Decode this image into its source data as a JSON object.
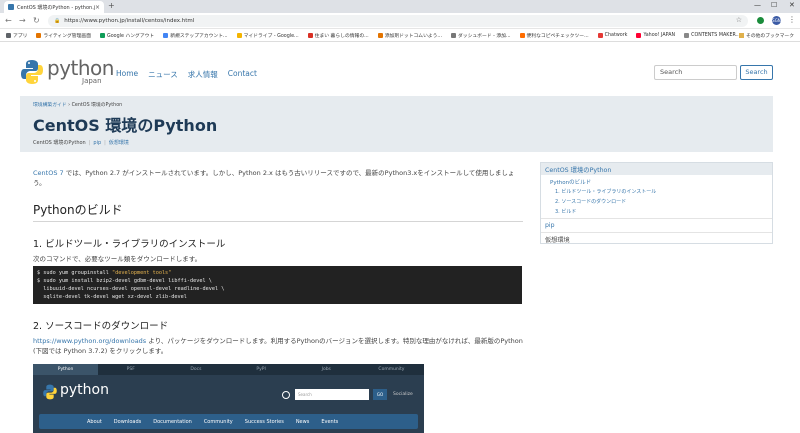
{
  "browser": {
    "tab_title": "CentOS 環境のPython - python.jp",
    "url": "https://www.python.jp/install/centos/index.html",
    "bookmarks": [
      {
        "label": "アプリ",
        "color": "#5f6368"
      },
      {
        "label": "ライティング管理画面",
        "color": "#e37400"
      },
      {
        "label": "Google ハングアウト",
        "color": "#0f9d58"
      },
      {
        "label": "新規ステップアカウント...",
        "color": "#4285f4"
      },
      {
        "label": "マイドライブ - Google...",
        "color": "#f4b400"
      },
      {
        "label": "住まい 暮らしの情報の...",
        "color": "#d93025"
      },
      {
        "label": "添加剤ドットコムいよう...",
        "color": "#e37400"
      },
      {
        "label": "ダッシュボード - 添加...",
        "color": "#777777"
      },
      {
        "label": "便利なコピペチェックツー...",
        "color": "#ff6d00"
      },
      {
        "label": "Chatwork",
        "color": "#e53935"
      },
      {
        "label": "Yahoo! JAPAN",
        "color": "#ff0033"
      },
      {
        "label": "CONTENTS MAKER...",
        "color": "#888888"
      }
    ],
    "other_bookmarks": "その他のブックマーク",
    "profile_initials": "SGN"
  },
  "header": {
    "logo_text": "python",
    "logo_sub": "Japan",
    "nav": [
      "Home",
      "ニュース",
      "求人情報",
      "Contact"
    ],
    "search_placeholder": "Search",
    "search_button": "Search"
  },
  "hero": {
    "breadcrumb_link": "環境構築ガイド",
    "breadcrumb_sep": "›",
    "breadcrumb_current": "CentOS 環境のPython",
    "title": "CentOS 環境のPython",
    "local_nav": [
      "CentOS 環境のPython",
      "pip",
      "仮想環境"
    ]
  },
  "content": {
    "intro_link": "CentOS 7",
    "intro_text": " では、Python 2.7 がインストールされています。しかし、Python 2.x はもう古いリリースですので、最新のPython3.xをインストールして使用しましょう。",
    "h1": "Pythonのビルド",
    "h2_1": "1. ビルドツール・ライブラリのインストール",
    "p_1": "次のコマンドで、必要なツール類をダウンロードします。",
    "code": {
      "line1_cmd": "$ sudo yum groupinstall ",
      "line1_str": "\"development tools\"",
      "line2": "$ sudo yum install bzip2-devel gdbm-devel libffi-devel \\",
      "line3": "  libuuid-devel ncurses-devel openssl-devel readline-devel \\",
      "line4": "  sqlite-devel tk-devel wget xz-devel zlib-devel"
    },
    "h2_2": "2. ソースコードのダウンロード",
    "p_2_link": "https://www.python.org/downloads",
    "p_2_text": " より、パッケージをダウンロードします。利用するPythonのバージョンを選択します。特別な理由がなければ、最新版のPython (下図では Python 3.7.2) をクリックします。",
    "screenshot": {
      "tabs": [
        "Python",
        "PSF",
        "Docs",
        "PyPI",
        "Jobs",
        "Community"
      ],
      "logo_text": "python",
      "search_placeholder": "Search",
      "go_label": "GO",
      "socialize": "Socialize",
      "nav": [
        "About",
        "Downloads",
        "Documentation",
        "Community",
        "Success Stories",
        "News",
        "Events"
      ]
    }
  },
  "sidebar": {
    "head": "CentOS 環境のPython",
    "sub": "Pythonのビルド",
    "steps": [
      "1. ビルドツール・ライブラリのインストール",
      "2. ソースコードのダウンロード",
      "3. ビルド"
    ],
    "pip": "pip",
    "venv": "仮想環境"
  }
}
